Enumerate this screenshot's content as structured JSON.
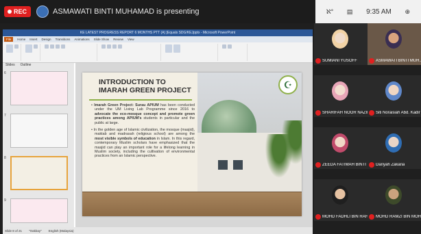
{
  "topbar": {
    "rec_label": "REC",
    "presenting_text": "ASMAWATI BINTI MUHAMAD is presenting"
  },
  "status": {
    "icon1": "ℵ°",
    "icon2": "▤",
    "time": "9:35 AM",
    "icon3": "⊕"
  },
  "ppt": {
    "title_text": "KE LATEST PROGRESS REPORT 6 MONTHS PTT (A) [Equals SDG/KEJpptx - Microsoft PowerPoint",
    "tabs": [
      "File",
      "Home",
      "Insert",
      "Design",
      "Transitions",
      "Animations",
      "Slide Show",
      "Review",
      "View"
    ],
    "panel_tabs": [
      "Slides",
      "Outline"
    ],
    "status_texts": [
      "Slide 8 of 21",
      "\"Oakbay\"",
      "English (Malaysia)"
    ]
  },
  "slide": {
    "title": "Introduction to Imarah Green Project",
    "bullets": [
      {
        "lead": "Imarah Green Project: Surau APIUM",
        "text": " has been conducted under the UM Living Lab Programme since 2016 to ",
        "bold2": "advocate the eco-mosque concept and promote green practices among APIUM's",
        "tail": " students in particular and the public at large."
      },
      {
        "lead": "",
        "text": "In the golden age of Islamic civilization, the mosque (masjid), maktab and madrasah (religious school) are among the ",
        "bold2": "most visible symbols of education",
        "tail": " in Islam. In this regard, contemporary Muslim scholars have emphasized that the masjid can play an important role for a lifelong learning in Muslim society, including the cultivation of environmental practices from an Islamic perspective."
      }
    ],
    "logo_glyph": "☪"
  },
  "gallery": [
    {
      "name": "SUMIANI YUSOFF",
      "skin": "#f0dccb",
      "scarf": "#f2d3a6"
    },
    {
      "name": "ASMAWATI BINTI MUH...",
      "skin": "#d9a47e",
      "scarf": "#3a2e52",
      "active": true
    },
    {
      "name": "SHARIFAH NOOR NAZIM...",
      "skin": "#f2ddcf",
      "scarf": "#e8a5b7"
    },
    {
      "name": "Siti Noraisiah Abd. Kadir",
      "skin": "#f0d6c2",
      "scarf": "#5f87c9"
    },
    {
      "name": "ZEEDA FATIMAH BINTI ...",
      "skin": "#f1d8c7",
      "scarf": "#c14b6b"
    },
    {
      "name": "Dariyah Zakaria",
      "skin": "#ead5c6",
      "scarf": "#2f6db3"
    },
    {
      "name": "MOHD FADHLI BIN RAH...",
      "skin": "#e6c2a2",
      "scarf": "#1f1f1f"
    },
    {
      "name": "MOHD RAMZI BIN MOH...",
      "skin": "#caa27e",
      "scarf": "#3d4a2a"
    }
  ]
}
